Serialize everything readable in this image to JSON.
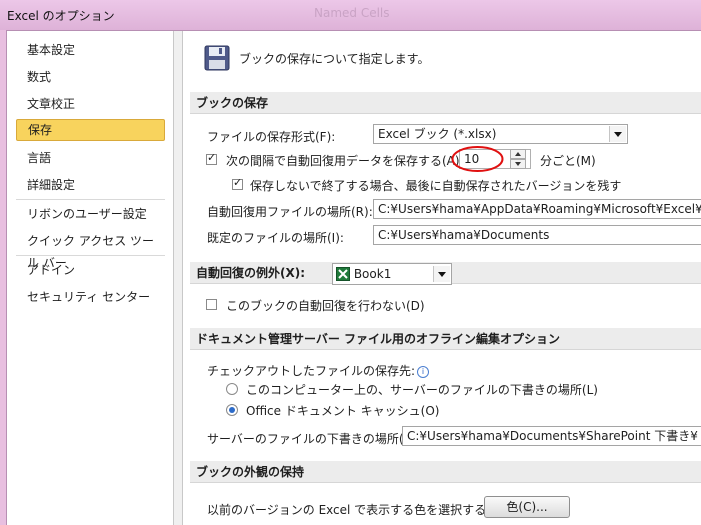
{
  "window": {
    "title": "Excel のオプション",
    "ghost_title": "Named Cells"
  },
  "sidebar": {
    "items": [
      {
        "label": "基本設定"
      },
      {
        "label": "数式"
      },
      {
        "label": "文章校正"
      },
      {
        "label": "保存",
        "selected": true
      },
      {
        "label": "言語"
      },
      {
        "label": "詳細設定"
      },
      {
        "label": "リボンのユーザー設定"
      },
      {
        "label": "クイック アクセス ツール バー"
      },
      {
        "label": "アドイン"
      },
      {
        "label": "セキュリティ センター"
      }
    ]
  },
  "header": {
    "icon": "floppy-disk-icon",
    "text": "ブックの保存について指定します。"
  },
  "save": {
    "section_title": "ブックの保存",
    "format_label": "ファイルの保存形式(F):",
    "format_value": "Excel ブック (*.xlsx)",
    "autorecover_label": "次の間隔で自動回復用データを保存する(A):",
    "autorecover_checked": true,
    "autorecover_minutes": "10",
    "minutes_unit": "分ごと(M)",
    "keep_last_label": "保存しないで終了する場合、最後に自動保存されたバージョンを残す",
    "keep_last_checked": true,
    "autorecover_location_label": "自動回復用ファイルの場所(R):",
    "autorecover_location_value": "C:¥Users¥hama¥AppData¥Roaming¥Microsoft¥Excel¥",
    "default_location_label": "既定のファイルの場所(I):",
    "default_location_value": "C:¥Users¥hama¥Documents"
  },
  "exceptions": {
    "label": "自動回復の例外(X):",
    "workbook": "Book1",
    "disable_label": "このブックの自動回復を行わない(D)",
    "disable_checked": false
  },
  "offline": {
    "section_title": "ドキュメント管理サーバー ファイル用のオフライン編集オプション",
    "checkout_label": "チェックアウトしたファイルの保存先:",
    "info_icon": "i",
    "option_computer": "このコンピューター上の、サーバーのファイルの下書きの場所(L)",
    "option_cache": "Office ドキュメント キャッシュ(O)",
    "selected_option": "cache",
    "drafts_label": "サーバーのファイルの下書きの場所(V):",
    "drafts_value": "C:¥Users¥hama¥Documents¥SharePoint 下書き¥"
  },
  "appearance": {
    "section_title": "ブックの外観の保持",
    "colors_label": "以前のバージョンの Excel で表示する色を選択する:",
    "colors_button": "色(C)..."
  },
  "colors": {
    "selected_item_bg": "#f8d35d",
    "highlight_circle": "#e01010",
    "excel_icon": "#1f7a3a"
  }
}
